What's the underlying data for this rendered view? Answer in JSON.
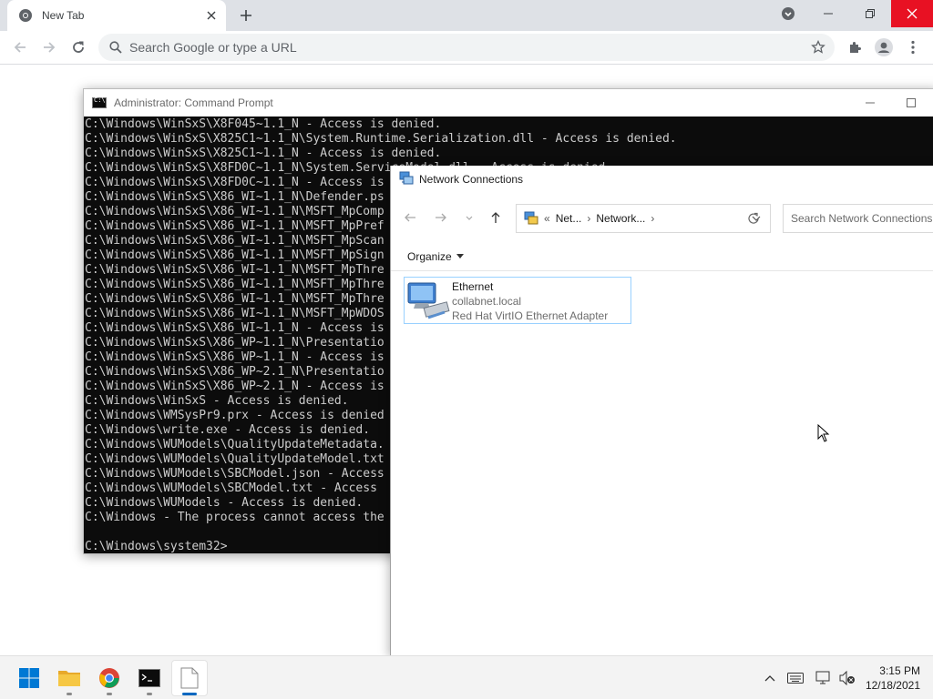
{
  "browser": {
    "tab_title": "New Tab",
    "omnibox_placeholder": "Search Google or type a URL"
  },
  "cmd": {
    "title": "Administrator: Command Prompt",
    "lines": [
      "C:\\Windows\\WinSxS\\X8F045~1.1_N - Access is denied.",
      "C:\\Windows\\WinSxS\\X825C1~1.1_N\\System.Runtime.Serialization.dll - Access is denied.",
      "C:\\Windows\\WinSxS\\X825C1~1.1_N - Access is denied.",
      "C:\\Windows\\WinSxS\\X8FD0C~1.1_N\\System.ServiceModel.dll - Access is denied.",
      "C:\\Windows\\WinSxS\\X8FD0C~1.1_N - Access is",
      "C:\\Windows\\WinSxS\\X86_WI~1.1_N\\Defender.ps",
      "C:\\Windows\\WinSxS\\X86_WI~1.1_N\\MSFT_MpComp",
      "C:\\Windows\\WinSxS\\X86_WI~1.1_N\\MSFT_MpPref",
      "C:\\Windows\\WinSxS\\X86_WI~1.1_N\\MSFT_MpScan",
      "C:\\Windows\\WinSxS\\X86_WI~1.1_N\\MSFT_MpSign",
      "C:\\Windows\\WinSxS\\X86_WI~1.1_N\\MSFT_MpThre",
      "C:\\Windows\\WinSxS\\X86_WI~1.1_N\\MSFT_MpThre",
      "C:\\Windows\\WinSxS\\X86_WI~1.1_N\\MSFT_MpThre",
      "C:\\Windows\\WinSxS\\X86_WI~1.1_N\\MSFT_MpWDOS",
      "C:\\Windows\\WinSxS\\X86_WI~1.1_N - Access is",
      "C:\\Windows\\WinSxS\\X86_WP~1.1_N\\Presentatio",
      "C:\\Windows\\WinSxS\\X86_WP~1.1_N - Access is",
      "C:\\Windows\\WinSxS\\X86_WP~2.1_N\\Presentatio",
      "C:\\Windows\\WinSxS\\X86_WP~2.1_N - Access is",
      "C:\\Windows\\WinSxS - Access is denied.",
      "C:\\Windows\\WMSysPr9.prx - Access is denied",
      "C:\\Windows\\write.exe - Access is denied.",
      "C:\\Windows\\WUModels\\QualityUpdateMetadata.",
      "C:\\Windows\\WUModels\\QualityUpdateModel.txt",
      "C:\\Windows\\WUModels\\SBCModel.json - Access",
      "C:\\Windows\\WUModels\\SBCModel.txt - Access",
      "C:\\Windows\\WUModels - Access is denied.",
      "C:\\Windows - The process cannot access the",
      "",
      "C:\\Windows\\system32>"
    ]
  },
  "network": {
    "title": "Network Connections",
    "breadcrumb_prefix": "«",
    "breadcrumb": [
      "Net...",
      "Network..."
    ],
    "search_placeholder": "Search Network Connections",
    "organize_label": "Organize",
    "adapter": {
      "name": "Ethernet",
      "domain": "collabnet.local",
      "device": "Red Hat VirtIO Ethernet Adapter"
    }
  },
  "taskbar": {
    "time": "3:15 PM",
    "date": "12/18/2021"
  }
}
